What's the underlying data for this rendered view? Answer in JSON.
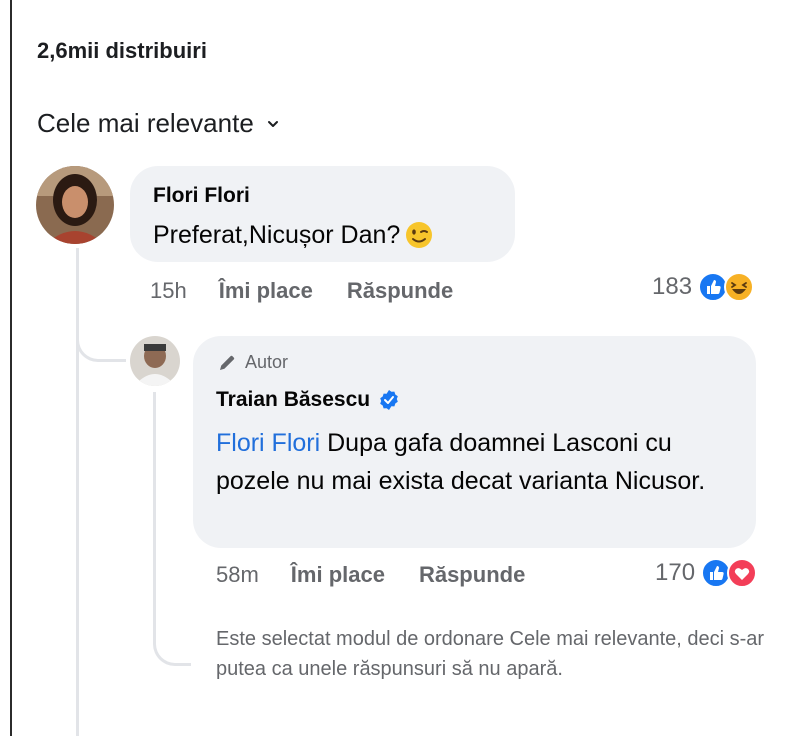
{
  "header": {
    "shares": "2,6mii distribuiri",
    "sort_label": "Cele mai relevante"
  },
  "comments": [
    {
      "author": "Flori Flori",
      "text": "Preferat,Nicușor Dan?",
      "emoji": "winking-face",
      "time": "15h",
      "like_label": "Îmi place",
      "reply_label": "Răspunde",
      "reaction_count": "183",
      "reactions": [
        "like",
        "haha"
      ]
    }
  ],
  "reply": {
    "author_tag": "Autor",
    "author": "Traian Băsescu",
    "verified": true,
    "mention": "Flori Flori",
    "text": " Dupa gafa doamnei Lasconi cu pozele nu mai exista decat varianta Nicusor.",
    "time": "58m",
    "like_label": "Îmi place",
    "reply_label": "Răspunde",
    "reaction_count": "170",
    "reactions": [
      "like",
      "love"
    ]
  },
  "notice": "Este selectat modul de ordonare Cele mai relevante, deci s-ar putea ca unele răspunsuri să nu apară.",
  "colors": {
    "bubble": "#f0f2f5",
    "mention": "#216fdb",
    "like": "#1877f2",
    "love": "#f33e58",
    "haha": "#f7b125",
    "secondary_text": "#65676b"
  }
}
